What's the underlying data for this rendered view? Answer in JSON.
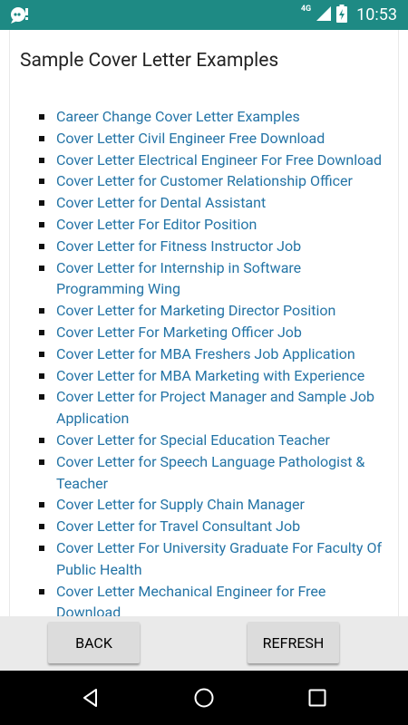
{
  "status": {
    "network": "4G",
    "time": "10:53"
  },
  "page": {
    "title": "Sample Cover Letter Examples",
    "links": [
      "Career Change Cover Letter Examples",
      "Cover Letter Civil Engineer Free Download",
      "Cover Letter Electrical Engineer For Free Download",
      "Cover Letter for Customer Relationship Officer",
      "Cover Letter for Dental Assistant",
      "Cover Letter For Editor Position",
      "Cover Letter for Fitness Instructor Job",
      "Cover Letter for Internship in Software Programming Wing",
      "Cover Letter for Marketing Director Position",
      "Cover Letter For Marketing Officer Job",
      "Cover Letter for MBA Freshers Job Application",
      "Cover Letter for MBA Marketing with Experience",
      "Cover Letter for Project Manager and Sample Job Application",
      "Cover Letter for Special Education Teacher",
      "Cover Letter for Speech Language Pathologist & Teacher",
      "Cover Letter for Supply Chain Manager",
      "Cover Letter for Travel Consultant Job",
      "Cover Letter For University Graduate For Faculty Of Public Health",
      "Cover Letter Mechanical Engineer for Free Download"
    ]
  },
  "buttons": {
    "back": "BACK",
    "refresh": "REFRESH"
  },
  "colors": {
    "status_bar": "#1e8a84",
    "link": "#2474a6",
    "button_bar": "#eaeaea",
    "button": "#dcdcdc"
  },
  "icons": {
    "status_left": "chat-bubble-icon",
    "signal": "signal-icon",
    "battery": "battery-charging-icon",
    "nav_back": "nav-back-icon",
    "nav_home": "nav-home-icon",
    "nav_recents": "nav-recents-icon"
  }
}
